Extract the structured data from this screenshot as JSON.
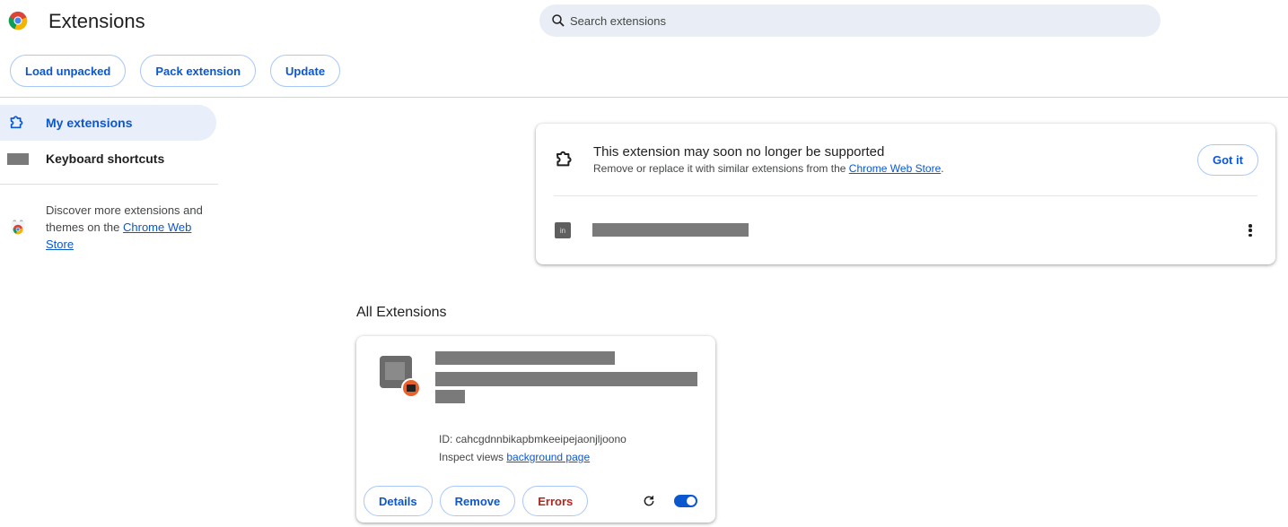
{
  "header": {
    "title": "Extensions",
    "search_placeholder": "Search extensions"
  },
  "toolbar": {
    "load_unpacked": "Load unpacked",
    "pack_extension": "Pack extension",
    "update": "Update"
  },
  "sidebar": {
    "items": [
      {
        "label": "My extensions",
        "icon": "puzzle-icon",
        "active": true
      },
      {
        "label": "Keyboard shortcuts",
        "icon": "keyboard-icon",
        "active": false
      }
    ],
    "discover_text": "Discover more extensions and themes on the ",
    "discover_link": "Chrome Web Store"
  },
  "warning": {
    "title": "This extension may soon no longer be supported",
    "desc_prefix": "Remove or replace it with similar extensions from the ",
    "desc_link": "Chrome Web Store",
    "desc_suffix": ".",
    "got_it": "Got it"
  },
  "all_extensions": {
    "title": "All Extensions",
    "card": {
      "id_text": "ID: cahcgdnnbikapbmkeeipejaonjljoono",
      "inspect_prefix": "Inspect views ",
      "inspect_link": "background page",
      "details": "Details",
      "remove": "Remove",
      "errors": "Errors",
      "enabled": true
    }
  },
  "colors": {
    "accent": "#0b57d0",
    "error": "#b3261e",
    "search_bg": "#e9eef6",
    "active_nav_bg": "#e8eefa"
  }
}
